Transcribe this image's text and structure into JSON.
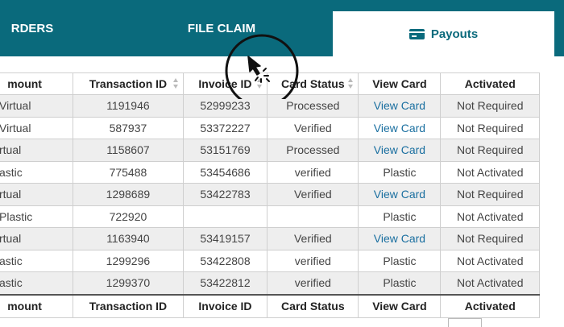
{
  "tabs": {
    "orders": "RDERS",
    "file_claim": "FILE CLAIM",
    "payouts": "Payouts"
  },
  "table": {
    "headers": [
      "mount",
      "Transaction ID",
      "Invoice ID",
      "Card Status",
      "View Card",
      "Activated"
    ],
    "rows": [
      [
        "Virtual",
        "1191946",
        "52999233",
        "Processed",
        "View Card",
        "Not Required"
      ],
      [
        "Virtual",
        "587937",
        "53372227",
        "Verified",
        "View Card",
        "Not Required"
      ],
      [
        "rtual",
        "1158607",
        "53151769",
        "Processed",
        "View Card",
        "Not Required"
      ],
      [
        "astic",
        "775488",
        "53454686",
        "verified",
        "Plastic",
        "Not Activated"
      ],
      [
        "rtual",
        "1298689",
        "53422783",
        "Verified",
        "View Card",
        "Not Required"
      ],
      [
        "Plastic",
        "722920",
        "",
        "",
        "Plastic",
        "Not Activated"
      ],
      [
        "rtual",
        "1163940",
        "53419157",
        "Verified",
        "View Card",
        "Not Required"
      ],
      [
        "astic",
        "1299296",
        "53422808",
        "verified",
        "Plastic",
        "Not Activated"
      ],
      [
        "astic",
        "1299370",
        "53422812",
        "verified",
        "Plastic",
        "Not Activated"
      ]
    ],
    "footers": [
      "mount",
      "Transaction ID",
      "Invoice ID",
      "Card Status",
      "View Card",
      "Activated"
    ]
  },
  "colors": {
    "header_bar": "#0a6a7c",
    "link": "#1a6fa0",
    "stripe": "#eeeeee"
  }
}
